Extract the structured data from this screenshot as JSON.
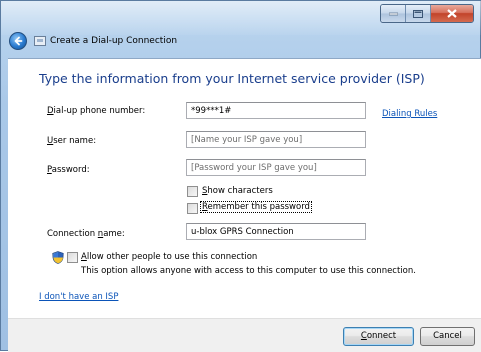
{
  "window": {
    "title": "Create a Dial-up Connection",
    "caption_buttons": [
      "minimize",
      "maximize",
      "close"
    ]
  },
  "heading": "Type the information from your Internet service provider (ISP)",
  "fields": {
    "phone": {
      "label_accel": "D",
      "label_rest": "ial-up phone number:",
      "value": "*99***1#"
    },
    "username": {
      "label_accel": "U",
      "label_rest": "ser name:",
      "placeholder": "[Name your ISP gave you]"
    },
    "password": {
      "label_accel": "P",
      "label_rest": "assword:",
      "placeholder": "[Password your ISP gave you]"
    },
    "connection_name": {
      "label_pre": "Connection ",
      "label_accel": "n",
      "label_rest": "ame:",
      "value": "u-blox GPRS Connection"
    }
  },
  "links": {
    "dialing_rules": "Dialing Rules",
    "no_isp": "I don't have an ISP"
  },
  "checkboxes": {
    "show_characters": {
      "accel": "S",
      "rest": "how characters",
      "checked": false
    },
    "remember_password": {
      "accel": "R",
      "rest": "emember this password",
      "checked": false
    },
    "allow_others": {
      "accel": "A",
      "rest": "llow other people to use this connection",
      "checked": false
    }
  },
  "allow_description": "This option allows anyone with access to this computer to use this connection.",
  "buttons": {
    "connect": {
      "accel": "C",
      "rest": "onnect"
    },
    "cancel": "Cancel"
  },
  "colors": {
    "heading": "#1a3e8c",
    "link": "#0b54b8",
    "frame": "#a9c8e8"
  },
  "icons": [
    "back-arrow-icon",
    "dialup-connection-icon",
    "uac-shield-icon",
    "minimize-icon",
    "maximize-icon",
    "close-icon"
  ]
}
